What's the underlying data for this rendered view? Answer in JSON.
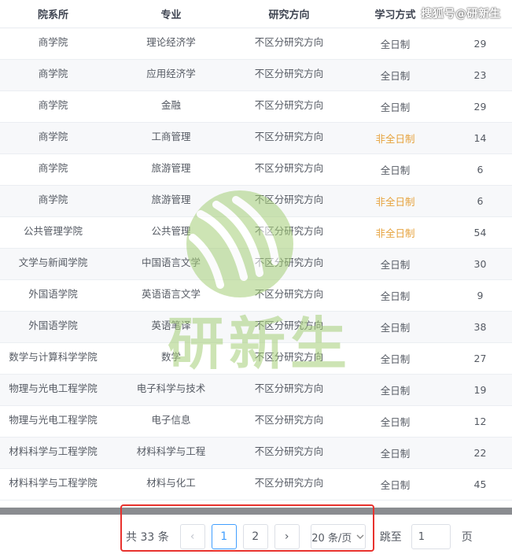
{
  "columns": [
    "院系所",
    "专业",
    "研究方向",
    "学习方式",
    ""
  ],
  "watermark_text": "搜狐号@研新生",
  "logo_text": "研新生",
  "rows": [
    {
      "dept": "商学院",
      "major": "理论经济学",
      "direction": "不区分研究方向",
      "mode": "全日制",
      "part_time": false,
      "count": "29"
    },
    {
      "dept": "商学院",
      "major": "应用经济学",
      "direction": "不区分研究方向",
      "mode": "全日制",
      "part_time": false,
      "count": "23"
    },
    {
      "dept": "商学院",
      "major": "金融",
      "direction": "不区分研究方向",
      "mode": "全日制",
      "part_time": false,
      "count": "29"
    },
    {
      "dept": "商学院",
      "major": "工商管理",
      "direction": "不区分研究方向",
      "mode": "非全日制",
      "part_time": true,
      "count": "14"
    },
    {
      "dept": "商学院",
      "major": "旅游管理",
      "direction": "不区分研究方向",
      "mode": "全日制",
      "part_time": false,
      "count": "6"
    },
    {
      "dept": "商学院",
      "major": "旅游管理",
      "direction": "不区分研究方向",
      "mode": "非全日制",
      "part_time": true,
      "count": "6"
    },
    {
      "dept": "公共管理学院",
      "major": "公共管理",
      "direction": "不区分研究方向",
      "mode": "非全日制",
      "part_time": true,
      "count": "54"
    },
    {
      "dept": "文学与新闻学院",
      "major": "中国语言文学",
      "direction": "不区分研究方向",
      "mode": "全日制",
      "part_time": false,
      "count": "30"
    },
    {
      "dept": "外国语学院",
      "major": "英语语言文学",
      "direction": "不区分研究方向",
      "mode": "全日制",
      "part_time": false,
      "count": "9"
    },
    {
      "dept": "外国语学院",
      "major": "英语笔译",
      "direction": "不区分研究方向",
      "mode": "全日制",
      "part_time": false,
      "count": "38"
    },
    {
      "dept": "数学与计算科学学院",
      "major": "数学",
      "direction": "不区分研究方向",
      "mode": "全日制",
      "part_time": false,
      "count": "27"
    },
    {
      "dept": "物理与光电工程学院",
      "major": "电子科学与技术",
      "direction": "不区分研究方向",
      "mode": "全日制",
      "part_time": false,
      "count": "19"
    },
    {
      "dept": "物理与光电工程学院",
      "major": "电子信息",
      "direction": "不区分研究方向",
      "mode": "全日制",
      "part_time": false,
      "count": "12"
    },
    {
      "dept": "材料科学与工程学院",
      "major": "材料科学与工程",
      "direction": "不区分研究方向",
      "mode": "全日制",
      "part_time": false,
      "count": "22"
    },
    {
      "dept": "材料科学与工程学院",
      "major": "材料与化工",
      "direction": "不区分研究方向",
      "mode": "全日制",
      "part_time": false,
      "count": "45"
    }
  ],
  "pagination": {
    "total_label": "共 33 条",
    "prev_icon": "‹",
    "pages": [
      "1",
      "2"
    ],
    "current_page": "1",
    "next_icon": "›",
    "page_size_label": "20 条/页",
    "jump_label": "跳至",
    "jump_value": "1",
    "page_suffix": "页"
  },
  "colors": {
    "part_time": "#e6a23c",
    "active_page": "#409eff",
    "highlight_box": "#e8322e",
    "logo_green": "#a5cf78"
  }
}
